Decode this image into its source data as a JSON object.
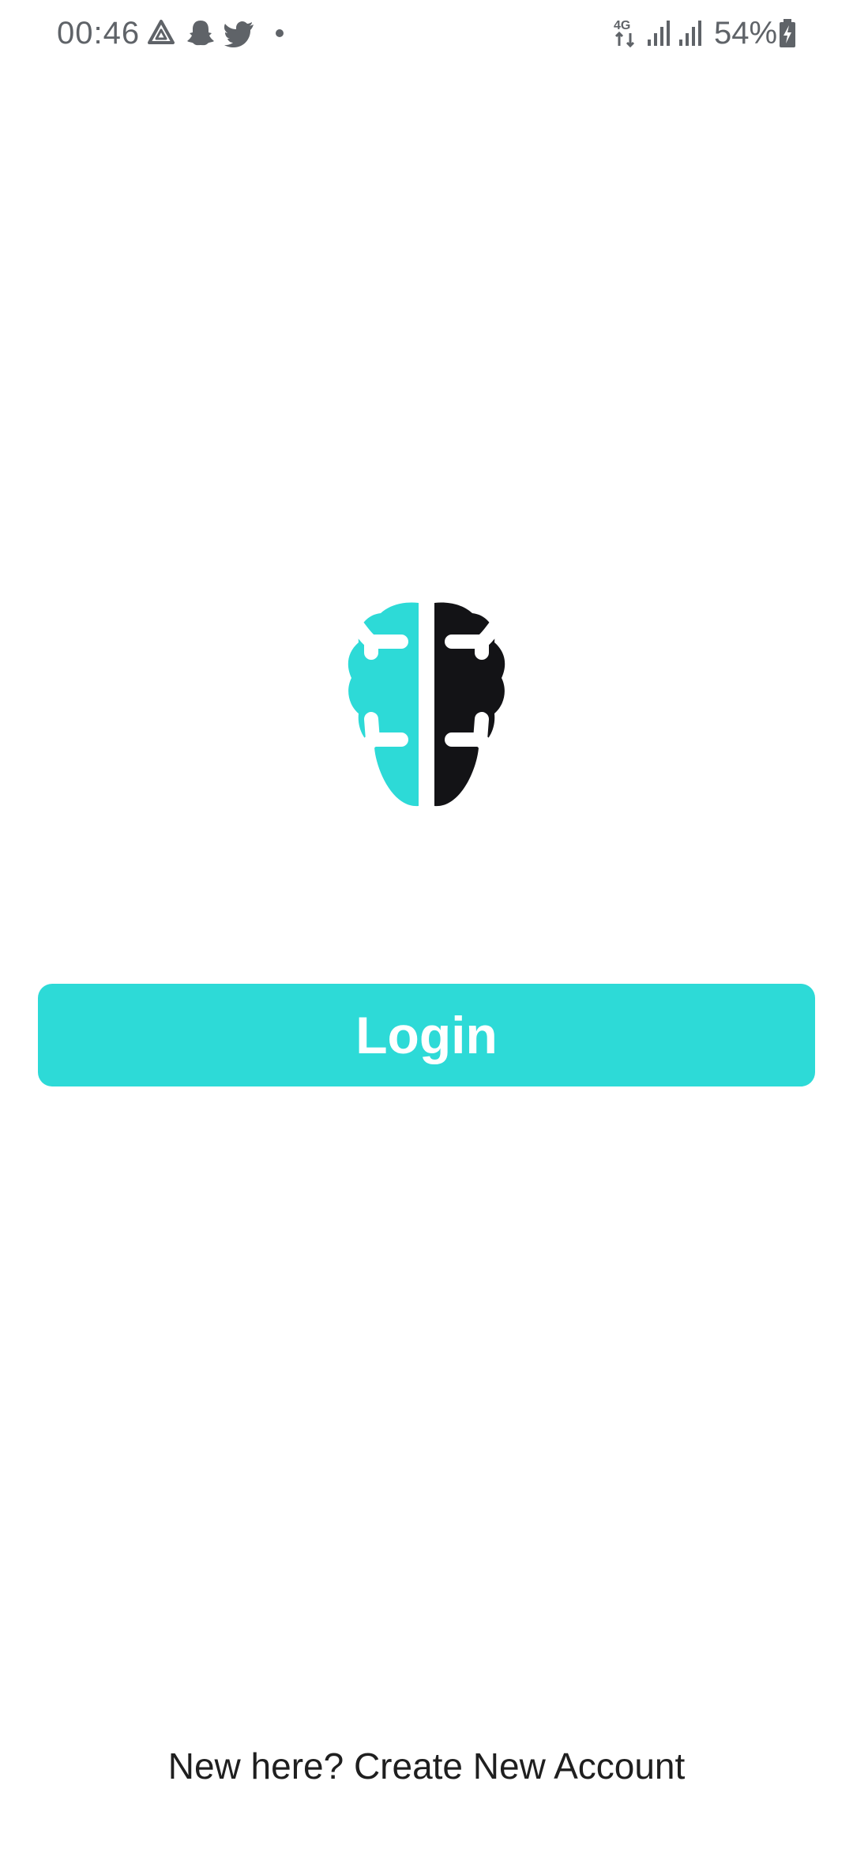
{
  "status_bar": {
    "time": "00:46",
    "notification_icons": [
      "drive-icon",
      "snapchat-icon",
      "twitter-icon",
      "more-dot-icon"
    ],
    "network_label": "4G",
    "battery_percent": "54%",
    "icons": [
      "network-4g-icon",
      "signal-icon",
      "signal-icon",
      "battery-charging-icon"
    ]
  },
  "logo": {
    "name": "brain-logo",
    "colors": {
      "left": "#2ddad7",
      "right": "#131316"
    }
  },
  "login_button": {
    "label": "Login",
    "color": "#2ddad7"
  },
  "footer": {
    "create_account_text": "New here? Create New Account"
  }
}
